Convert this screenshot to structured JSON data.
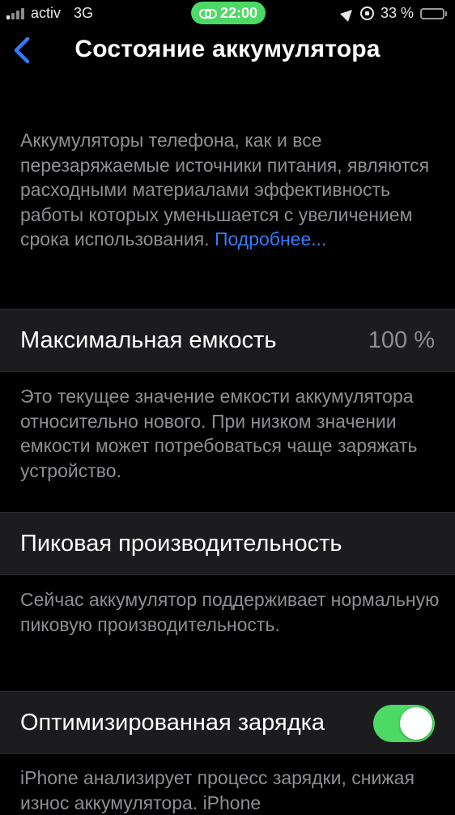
{
  "status_bar": {
    "carrier": "activ",
    "network": "3G",
    "time": "22:00",
    "battery_percent": "33 %",
    "battery_level": 0.33,
    "pill_color": "#4cd964",
    "battery_color": "#ffcc00"
  },
  "nav": {
    "back_icon": "chevron-left-icon",
    "title": "Состояние аккумулятора"
  },
  "intro": {
    "text": "Аккумуляторы телефона, как и все перезаряжаемые источники питания, являются расходными материалами эффективность работы которых уменьшается с увеличением срока использования.",
    "link": "Подробнее..."
  },
  "max_capacity": {
    "label": "Максимальная емкость",
    "value": "100 %",
    "footnote": "Это текущее значение емкости аккумулятора относительно нового. При низком значении емкости может потребоваться чаще заряжать устройство."
  },
  "peak_performance": {
    "label": "Пиковая производительность",
    "footnote": "Сейчас аккумулятор поддерживает нормальную пиковую производительность."
  },
  "optimized_charging": {
    "label": "Оптимизированная зарядка",
    "enabled": true,
    "footnote": "iPhone анализирует процесс зарядки, снижая износ аккумулятора. iPhone"
  },
  "colors": {
    "accent": "#2f7cf6",
    "toggle_on": "#4cd964",
    "secondary_text": "#8e8e93",
    "cell_bg": "#1c1c1e"
  }
}
